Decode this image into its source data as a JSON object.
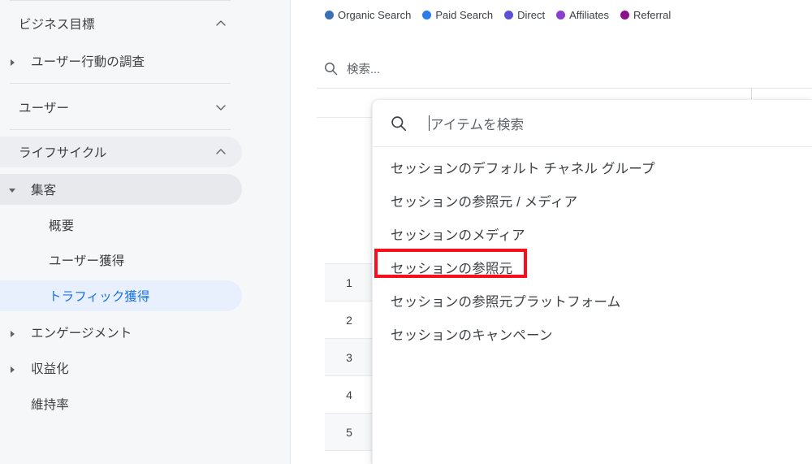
{
  "sidebar": {
    "sections": [
      {
        "label": "ビジネス目標",
        "icon": "chevron-up-icon",
        "state": "expanded"
      },
      {
        "label": "ユーザー行動の調査",
        "icon": "triangle-right-icon",
        "state": "collapsed"
      },
      {
        "label": "ユーザー",
        "icon": "chevron-down-icon",
        "state": "collapsed"
      },
      {
        "label": "ライフサイクル",
        "icon": "chevron-up-icon",
        "state": "expanded"
      },
      {
        "label": "集客",
        "icon": "triangle-down-icon",
        "state": "expanded"
      },
      {
        "label": "概要",
        "icon": "",
        "state": "leaf"
      },
      {
        "label": "ユーザー獲得",
        "icon": "",
        "state": "leaf"
      },
      {
        "label": "トラフィック獲得",
        "icon": "",
        "state": "selected"
      },
      {
        "label": "エンゲージメント",
        "icon": "triangle-right-icon",
        "state": "collapsed"
      },
      {
        "label": "収益化",
        "icon": "triangle-right-icon",
        "state": "collapsed"
      },
      {
        "label": "維持率",
        "icon": "",
        "state": "leaf"
      }
    ],
    "selected_color": "#1a73e8",
    "selected_bg": "#e8f0fe"
  },
  "legend": {
    "items": [
      {
        "label": "Organic Search",
        "color": "#3c6fb4"
      },
      {
        "label": "Paid Search",
        "color": "#2b7de9"
      },
      {
        "label": "Direct",
        "color": "#5b50d6"
      },
      {
        "label": "Affiliates",
        "color": "#8a3fd1"
      },
      {
        "label": "Referral",
        "color": "#8d0f8d"
      }
    ]
  },
  "page_search": {
    "icon": "search-icon",
    "placeholder": "検索..."
  },
  "table": {
    "row_numbers": [
      "1",
      "2",
      "3",
      "4",
      "5"
    ]
  },
  "dropdown": {
    "search": {
      "icon": "search-icon",
      "placeholder": "アイテムを検索",
      "value": ""
    },
    "items": [
      "セッションのデフォルト チャネル グループ",
      "セッションの参照元 / メディア",
      "セッションのメディア",
      "セッションの参照元",
      "セッションの参照元プラットフォーム",
      "セッションのキャンペーン"
    ],
    "highlighted_item": "セッションの参照元",
    "highlight_color": "#fc0d1b"
  }
}
